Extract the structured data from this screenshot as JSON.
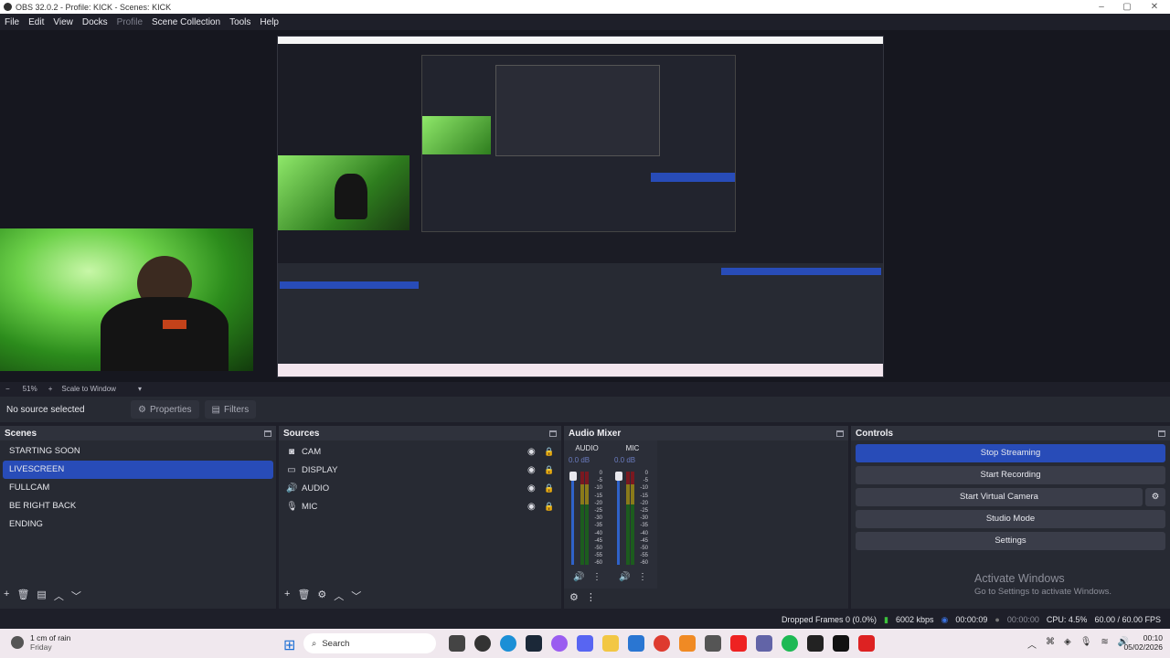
{
  "window": {
    "title": "OBS 32.0.2 - Profile: KICK - Scenes: KICK"
  },
  "menu": [
    "File",
    "Edit",
    "View",
    "Docks",
    "Profile",
    "Scene Collection",
    "Tools",
    "Help"
  ],
  "zoom": {
    "minus": "−",
    "value": "51%",
    "plus": "+",
    "mode": "Scale to Window"
  },
  "source_toolbar": {
    "status": "No source selected",
    "properties": "Properties",
    "filters": "Filters"
  },
  "scenes": {
    "title": "Scenes",
    "items": [
      "STARTING SOON",
      "LIVESCREEN",
      "FULLCAM",
      "BE RIGHT BACK",
      "ENDING"
    ],
    "selected": "LIVESCREEN"
  },
  "sources": {
    "title": "Sources",
    "items": [
      {
        "name": "CAM",
        "icon": "camera-icon"
      },
      {
        "name": "DISPLAY",
        "icon": "monitor-icon"
      },
      {
        "name": "AUDIO",
        "icon": "speaker-icon"
      },
      {
        "name": "MIC",
        "icon": "microphone-icon"
      }
    ]
  },
  "mixer": {
    "title": "Audio Mixer",
    "channels": [
      {
        "name": "AUDIO",
        "db": "0.0 dB"
      },
      {
        "name": "MIC",
        "db": "0.0 dB"
      }
    ],
    "scale": [
      "0",
      "-5",
      "-10",
      "-15",
      "-20",
      "-25",
      "-30",
      "-35",
      "-40",
      "-45",
      "-50",
      "-55",
      "-60"
    ]
  },
  "controls": {
    "title": "Controls",
    "stop_streaming": "Stop Streaming",
    "start_recording": "Start Recording",
    "start_virtual_camera": "Start Virtual Camera",
    "studio_mode": "Studio Mode",
    "settings": "Settings"
  },
  "watermark": {
    "line1": "Activate Windows",
    "line2": "Go to Settings to activate Windows."
  },
  "status": {
    "dropped": "Dropped Frames 0 (0.0%)",
    "bitrate": "6002 kbps",
    "stream_time": "00:00:09",
    "rec_time": "00:00:00",
    "cpu": "CPU: 4.5%",
    "fps": "60.00 / 60.00 FPS"
  },
  "taskbar": {
    "weather": "1 cm of rain",
    "weather_sub": "Friday",
    "search": "Search",
    "time": "00:10",
    "date": "05/02/2026"
  },
  "colors": {
    "accent": "#284cb8",
    "panel": "#272a33",
    "bg": "#1e1f29"
  }
}
